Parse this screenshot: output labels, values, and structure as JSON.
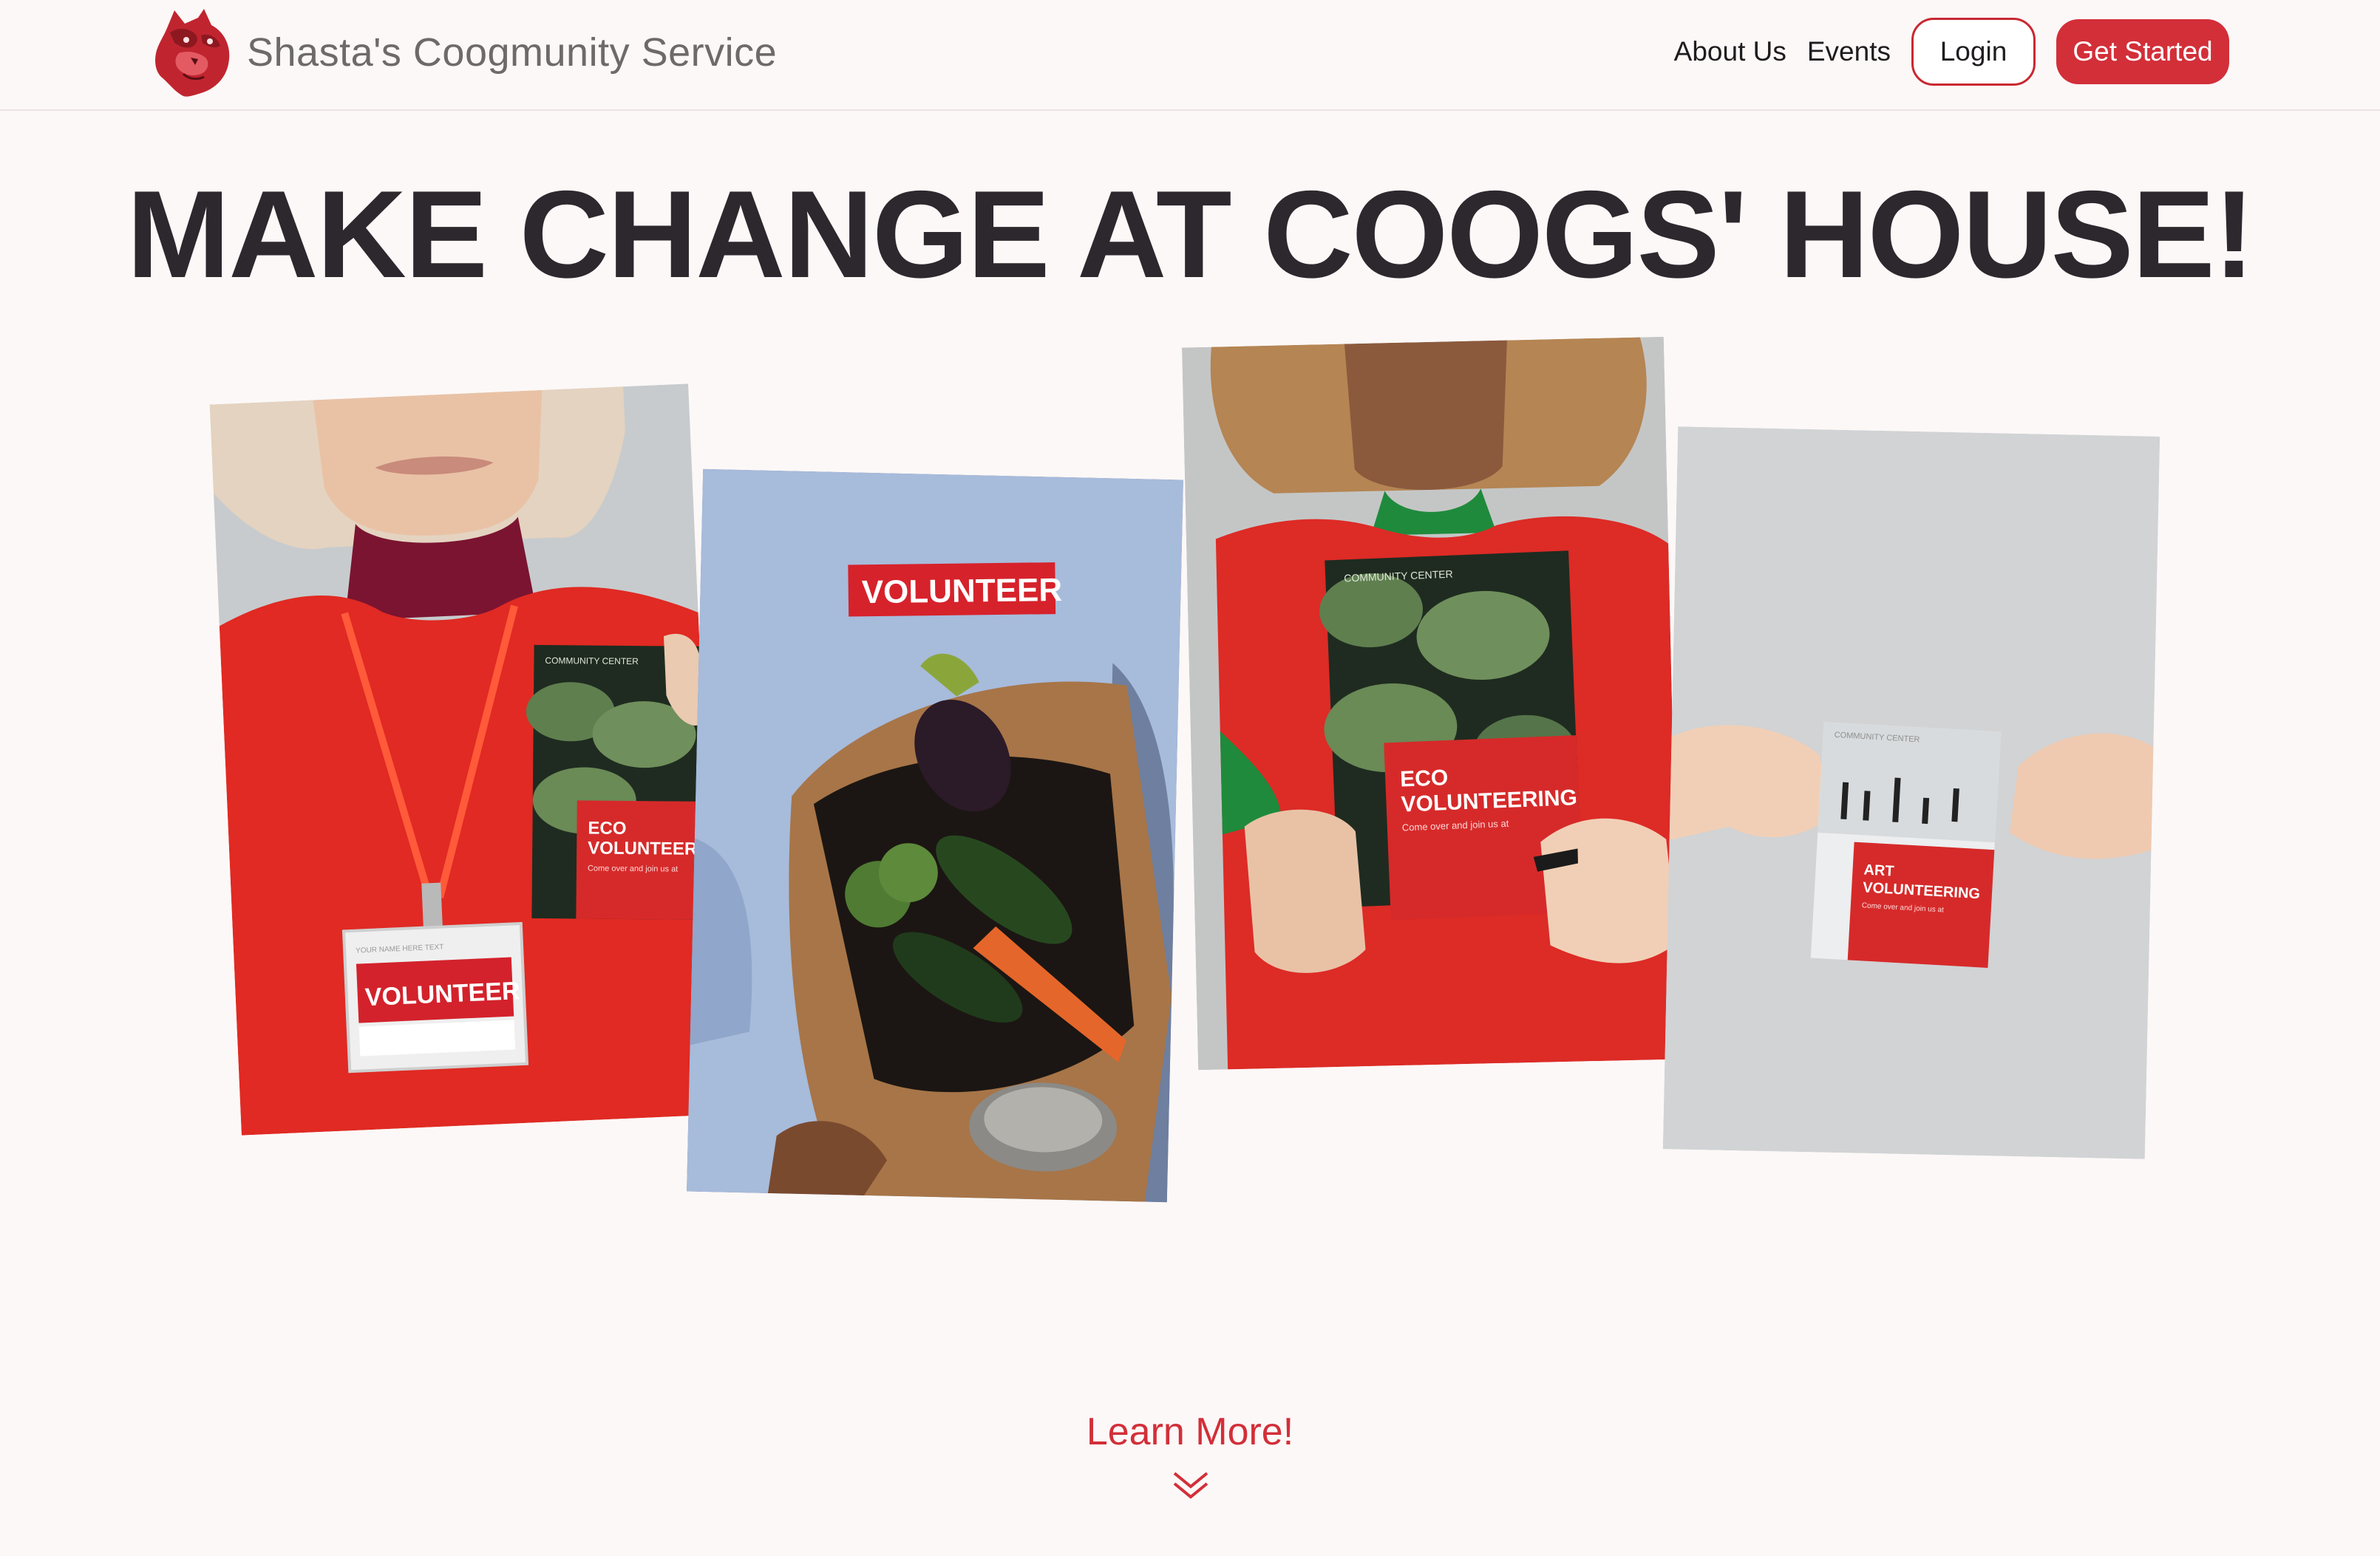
{
  "brand": {
    "name": "Shasta's Coogmunity Service",
    "logo_icon": "cougar-head-logo-icon"
  },
  "nav": {
    "about": "About Us",
    "events": "Events",
    "login": "Login",
    "get_started": "Get Started"
  },
  "hero": {
    "headline": "MAKE CHANGE AT COOGS' HOUSE!"
  },
  "photos": {
    "p1": {
      "brochure_small": "COMMUNITY CENTER",
      "brochure_title_1": "ECO",
      "brochure_title_2": "VOLUNTEERING",
      "brochure_sub": "Come over and join us at",
      "badge_small": "YOUR NAME HERE TEXT",
      "badge": "VOLUNTEER"
    },
    "p2": {
      "sticker": "VOLUNTEER"
    },
    "p3": {
      "brochure_small": "COMMUNITY CENTER",
      "brochure_title_1": "ECO",
      "brochure_title_2": "VOLUNTEERING",
      "brochure_sub": "Come over and join us at"
    },
    "p4": {
      "brochure_small": "COMMUNITY CENTER",
      "brochure_title_1": "ART",
      "brochure_title_2": "VOLUNTEERING",
      "brochure_sub": "Come over and join us at"
    }
  },
  "cta": {
    "learn_more": "Learn More!",
    "icon": "double-chevron-down-icon"
  },
  "colors": {
    "accent": "#d22f39",
    "background": "#fcf8f7",
    "headline": "#2d282e"
  }
}
